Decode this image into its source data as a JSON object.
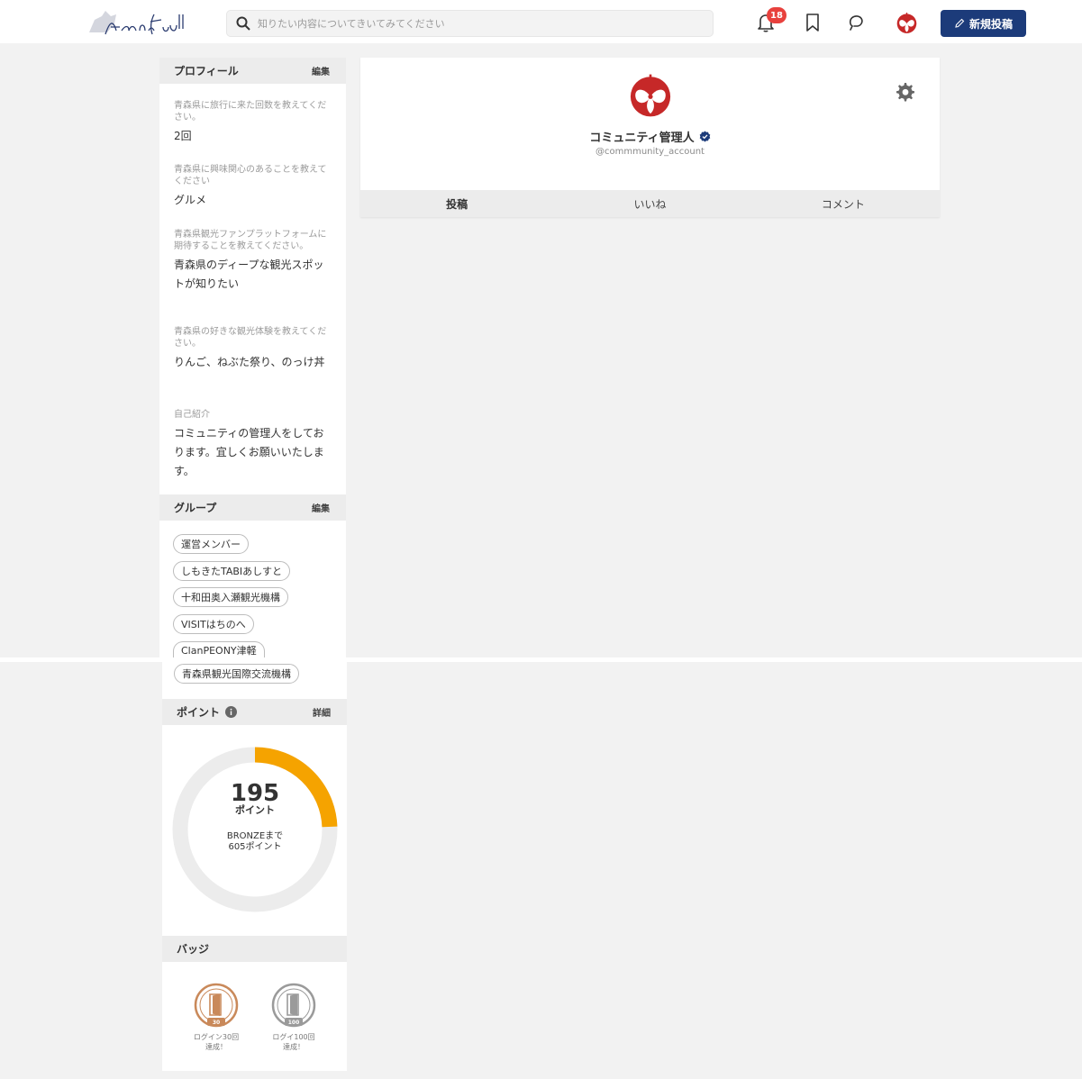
{
  "header": {
    "search_placeholder": "知りたい内容についてきいてみてください",
    "notification_count": "18",
    "new_post_label": "新規投稿"
  },
  "profile_section": {
    "title": "プロフィール",
    "edit_label": "編集",
    "items": [
      {
        "question": "青森県に旅行に来た回数を教えてください。",
        "answer": "2回"
      },
      {
        "question": "青森県に興味関心のあることを教えてください",
        "answer": "グルメ"
      },
      {
        "question": "青森県観光ファンプラットフォームに期待することを教えてください。",
        "answer": "青森県のディープな観光スポットが知りたい"
      },
      {
        "question": "青森県の好きな観光体験を教えてください。",
        "answer": "りんご、ねぶた祭り、のっけ丼"
      },
      {
        "question": "自己紹介",
        "answer": "コミュニティの管理人をしております。宜しくお願いいたします。"
      }
    ]
  },
  "group_section": {
    "title": "グループ",
    "edit_label": "編集",
    "tags": [
      "運営メンバー",
      "しもきたTABIあしすと",
      "十和田奥入瀬観光機構",
      "VISITはちのへ",
      "ClanPEONY津軽",
      "青森県観光国際交流機構"
    ]
  },
  "points_section": {
    "title": "ポイント",
    "detail_label": "詳細",
    "value": "195",
    "unit": "ポイント",
    "next_rank_line1": "BRONZEまで",
    "next_rank_line2": "605ポイント",
    "progress_fraction": 0.244
  },
  "badge_section": {
    "title": "バッジ",
    "badges": [
      {
        "number": "30",
        "caption_line1": "ログイン30回",
        "caption_line2": "達成！",
        "color": "#c9895a"
      },
      {
        "number": "100",
        "caption_line1": "ログイ100回",
        "caption_line2": "達成！",
        "color": "#9a9a9a"
      }
    ]
  },
  "profile": {
    "display_name": "コミュニティ管理人",
    "handle": "@commmunity_account"
  },
  "tabs": [
    "投稿",
    "いいね",
    "コメント"
  ],
  "colors": {
    "brand": "#1c3b7a",
    "accent": "#f5a300",
    "badge_red": "#e8413d",
    "avatar_red": "#c62828"
  }
}
